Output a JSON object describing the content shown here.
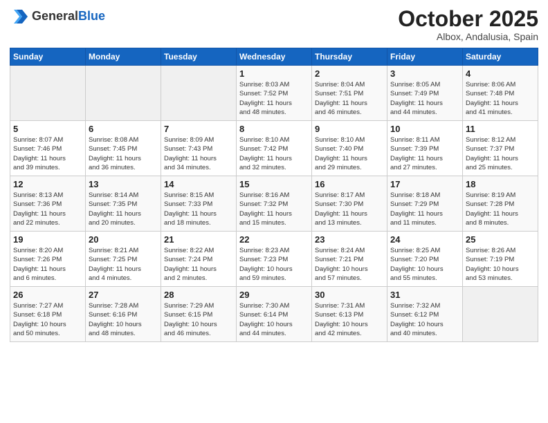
{
  "header": {
    "logo_general": "General",
    "logo_blue": "Blue",
    "month": "October 2025",
    "location": "Albox, Andalusia, Spain"
  },
  "days_of_week": [
    "Sunday",
    "Monday",
    "Tuesday",
    "Wednesday",
    "Thursday",
    "Friday",
    "Saturday"
  ],
  "weeks": [
    [
      {
        "day": "",
        "info": ""
      },
      {
        "day": "",
        "info": ""
      },
      {
        "day": "",
        "info": ""
      },
      {
        "day": "1",
        "info": "Sunrise: 8:03 AM\nSunset: 7:52 PM\nDaylight: 11 hours\nand 48 minutes."
      },
      {
        "day": "2",
        "info": "Sunrise: 8:04 AM\nSunset: 7:51 PM\nDaylight: 11 hours\nand 46 minutes."
      },
      {
        "day": "3",
        "info": "Sunrise: 8:05 AM\nSunset: 7:49 PM\nDaylight: 11 hours\nand 44 minutes."
      },
      {
        "day": "4",
        "info": "Sunrise: 8:06 AM\nSunset: 7:48 PM\nDaylight: 11 hours\nand 41 minutes."
      }
    ],
    [
      {
        "day": "5",
        "info": "Sunrise: 8:07 AM\nSunset: 7:46 PM\nDaylight: 11 hours\nand 39 minutes."
      },
      {
        "day": "6",
        "info": "Sunrise: 8:08 AM\nSunset: 7:45 PM\nDaylight: 11 hours\nand 36 minutes."
      },
      {
        "day": "7",
        "info": "Sunrise: 8:09 AM\nSunset: 7:43 PM\nDaylight: 11 hours\nand 34 minutes."
      },
      {
        "day": "8",
        "info": "Sunrise: 8:10 AM\nSunset: 7:42 PM\nDaylight: 11 hours\nand 32 minutes."
      },
      {
        "day": "9",
        "info": "Sunrise: 8:10 AM\nSunset: 7:40 PM\nDaylight: 11 hours\nand 29 minutes."
      },
      {
        "day": "10",
        "info": "Sunrise: 8:11 AM\nSunset: 7:39 PM\nDaylight: 11 hours\nand 27 minutes."
      },
      {
        "day": "11",
        "info": "Sunrise: 8:12 AM\nSunset: 7:37 PM\nDaylight: 11 hours\nand 25 minutes."
      }
    ],
    [
      {
        "day": "12",
        "info": "Sunrise: 8:13 AM\nSunset: 7:36 PM\nDaylight: 11 hours\nand 22 minutes."
      },
      {
        "day": "13",
        "info": "Sunrise: 8:14 AM\nSunset: 7:35 PM\nDaylight: 11 hours\nand 20 minutes."
      },
      {
        "day": "14",
        "info": "Sunrise: 8:15 AM\nSunset: 7:33 PM\nDaylight: 11 hours\nand 18 minutes."
      },
      {
        "day": "15",
        "info": "Sunrise: 8:16 AM\nSunset: 7:32 PM\nDaylight: 11 hours\nand 15 minutes."
      },
      {
        "day": "16",
        "info": "Sunrise: 8:17 AM\nSunset: 7:30 PM\nDaylight: 11 hours\nand 13 minutes."
      },
      {
        "day": "17",
        "info": "Sunrise: 8:18 AM\nSunset: 7:29 PM\nDaylight: 11 hours\nand 11 minutes."
      },
      {
        "day": "18",
        "info": "Sunrise: 8:19 AM\nSunset: 7:28 PM\nDaylight: 11 hours\nand 8 minutes."
      }
    ],
    [
      {
        "day": "19",
        "info": "Sunrise: 8:20 AM\nSunset: 7:26 PM\nDaylight: 11 hours\nand 6 minutes."
      },
      {
        "day": "20",
        "info": "Sunrise: 8:21 AM\nSunset: 7:25 PM\nDaylight: 11 hours\nand 4 minutes."
      },
      {
        "day": "21",
        "info": "Sunrise: 8:22 AM\nSunset: 7:24 PM\nDaylight: 11 hours\nand 2 minutes."
      },
      {
        "day": "22",
        "info": "Sunrise: 8:23 AM\nSunset: 7:23 PM\nDaylight: 10 hours\nand 59 minutes."
      },
      {
        "day": "23",
        "info": "Sunrise: 8:24 AM\nSunset: 7:21 PM\nDaylight: 10 hours\nand 57 minutes."
      },
      {
        "day": "24",
        "info": "Sunrise: 8:25 AM\nSunset: 7:20 PM\nDaylight: 10 hours\nand 55 minutes."
      },
      {
        "day": "25",
        "info": "Sunrise: 8:26 AM\nSunset: 7:19 PM\nDaylight: 10 hours\nand 53 minutes."
      }
    ],
    [
      {
        "day": "26",
        "info": "Sunrise: 7:27 AM\nSunset: 6:18 PM\nDaylight: 10 hours\nand 50 minutes."
      },
      {
        "day": "27",
        "info": "Sunrise: 7:28 AM\nSunset: 6:16 PM\nDaylight: 10 hours\nand 48 minutes."
      },
      {
        "day": "28",
        "info": "Sunrise: 7:29 AM\nSunset: 6:15 PM\nDaylight: 10 hours\nand 46 minutes."
      },
      {
        "day": "29",
        "info": "Sunrise: 7:30 AM\nSunset: 6:14 PM\nDaylight: 10 hours\nand 44 minutes."
      },
      {
        "day": "30",
        "info": "Sunrise: 7:31 AM\nSunset: 6:13 PM\nDaylight: 10 hours\nand 42 minutes."
      },
      {
        "day": "31",
        "info": "Sunrise: 7:32 AM\nSunset: 6:12 PM\nDaylight: 10 hours\nand 40 minutes."
      },
      {
        "day": "",
        "info": ""
      }
    ]
  ]
}
